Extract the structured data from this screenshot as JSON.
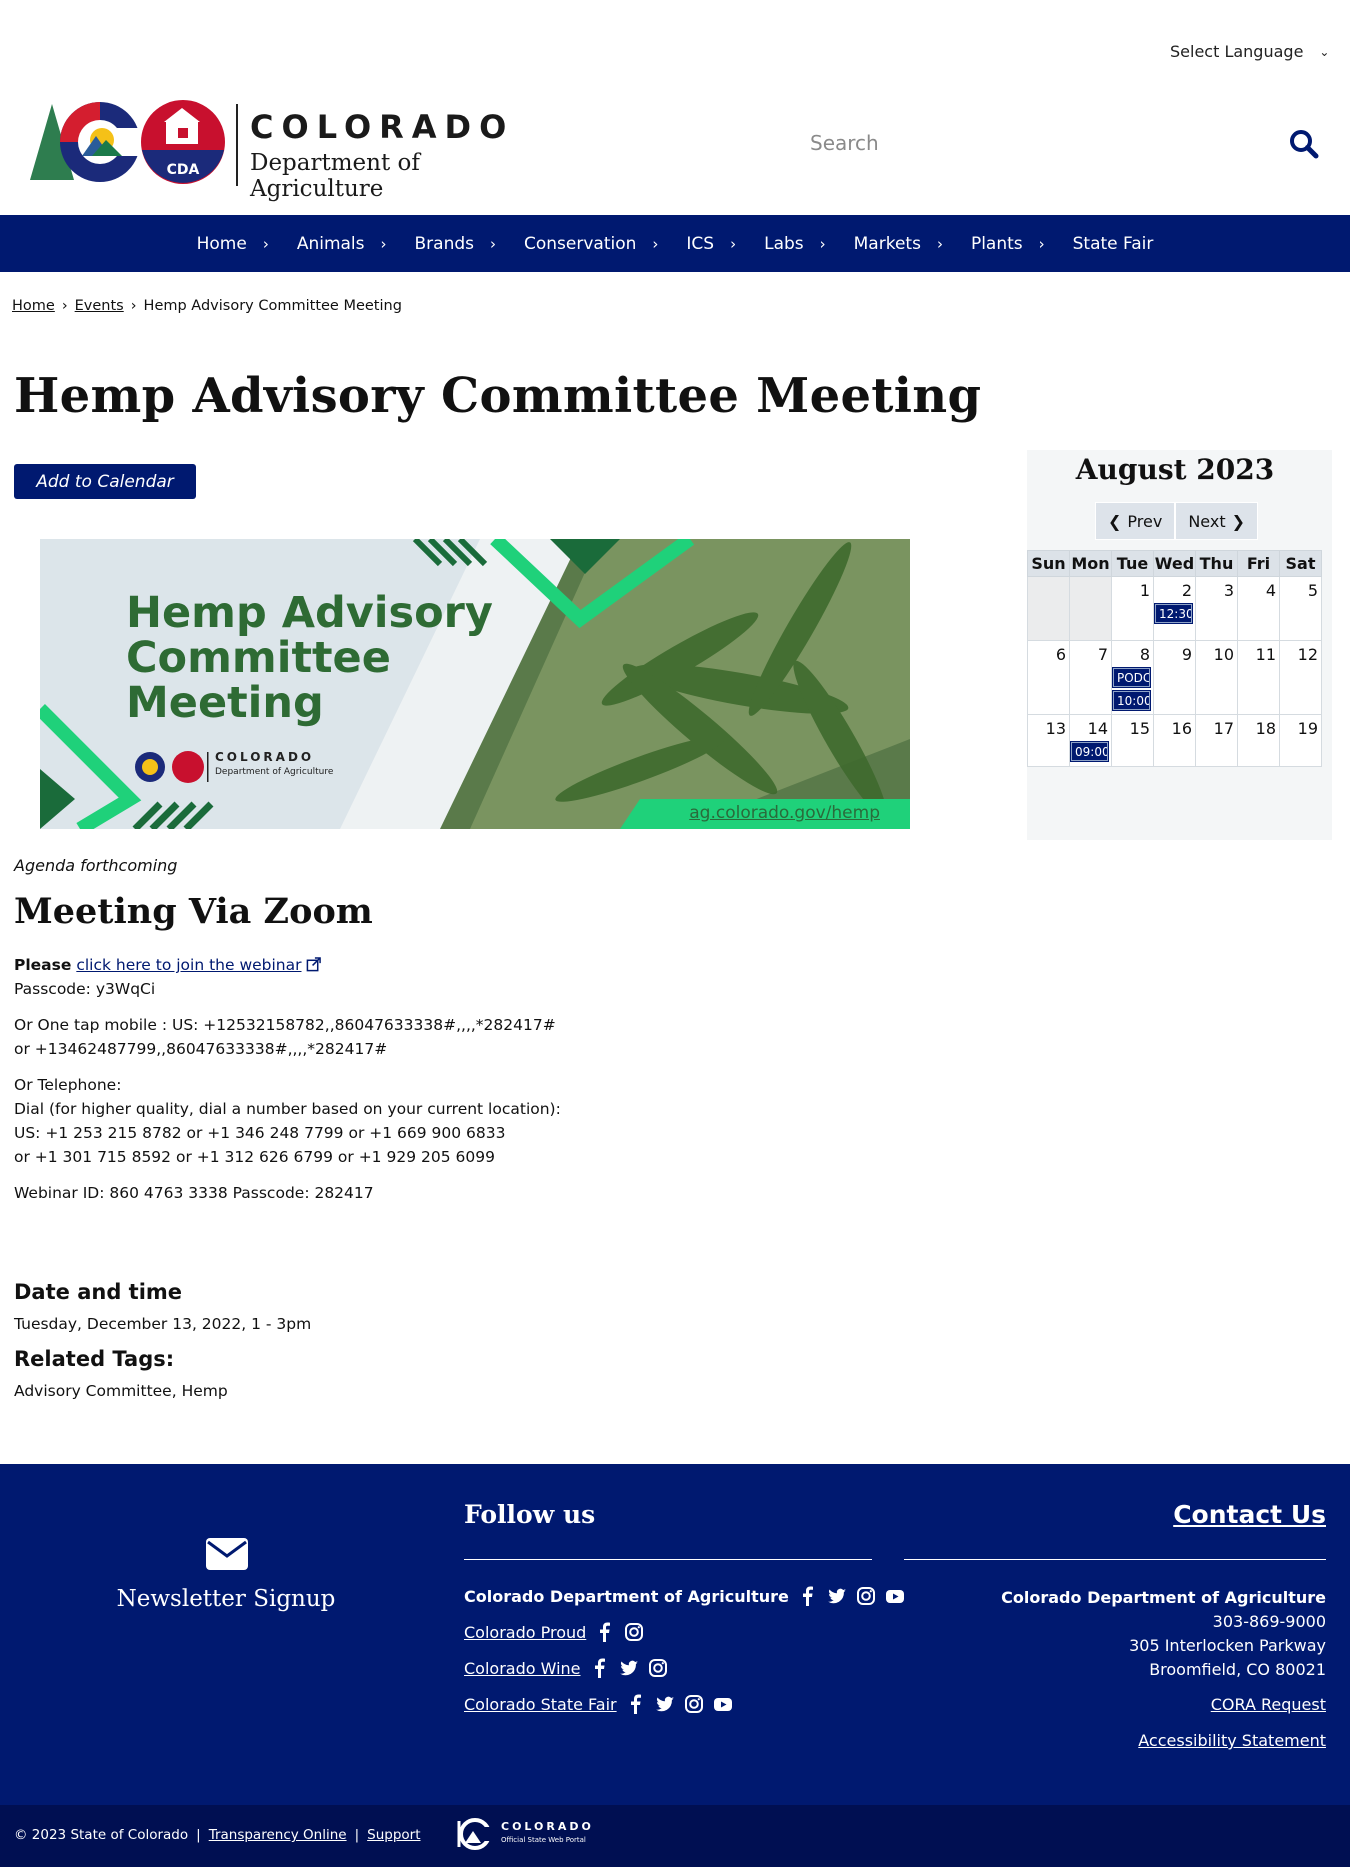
{
  "header": {
    "language_label": "Select Language",
    "logo_title": "COLORADO",
    "logo_subtitle": "Department of Agriculture",
    "logo_badge": "CDA",
    "search_placeholder": "Search"
  },
  "nav": {
    "items": [
      "Home",
      "Animals",
      "Brands",
      "Conservation",
      "ICS",
      "Labs",
      "Markets",
      "Plants",
      "State Fair"
    ],
    "background_color": "#001970"
  },
  "breadcrumb": {
    "items": [
      "Home",
      "Events",
      "Hemp Advisory Committee Meeting"
    ]
  },
  "page": {
    "title": "Hemp Advisory Committee Meeting",
    "add_to_calendar": "Add to Calendar"
  },
  "banner": {
    "title_line1": "Hemp Advisory",
    "title_line2": "Committee",
    "title_line3": "Meeting",
    "logo_title": "COLORADO",
    "logo_subtitle": "Department of Agriculture",
    "url": "ag.colorado.gov/hemp"
  },
  "content": {
    "agenda": "Agenda forthcoming",
    "zoom_heading": "Meeting Via Zoom",
    "please": "Please",
    "join_link": "click here to join the webinar",
    "passcode": "Passcode: y3WqCi",
    "one_tap_1": "Or One tap mobile : US: +12532158782,,86047633338#,,,,*282417#",
    "one_tap_2": "or +13462487799,,86047633338#,,,,*282417#",
    "telephone_label": "Or Telephone:",
    "dial_note": "Dial (for higher quality, dial a number based on your current location):",
    "numbers_1": "US: +1 253 215 8782 or +1 346 248 7799 or +1 669 900 6833",
    "numbers_2": "or +1 301 715 8592 or +1 312 626 6799 or +1 929 205 6099",
    "webinar_id": "Webinar ID: 860 4763 3338 Passcode: 282417",
    "date_heading": "Date and time",
    "date_value": "Tuesday, December 13, 2022, 1 - 3pm",
    "tags_heading": "Related Tags:",
    "tags_value": "Advisory Committee, Hemp"
  },
  "calendar": {
    "month_label": "August 2023",
    "prev_label": "Prev",
    "next_label": "Next",
    "weekdays": [
      "Sun",
      "Mon",
      "Tue",
      "Wed",
      "Thu",
      "Fri",
      "Sat"
    ],
    "weeks": [
      [
        {
          "day": ""
        },
        {
          "day": ""
        },
        {
          "day": "1"
        },
        {
          "day": "2",
          "events": [
            "12:30"
          ]
        },
        {
          "day": "3"
        },
        {
          "day": "4"
        },
        {
          "day": "5"
        }
      ],
      [
        {
          "day": "6"
        },
        {
          "day": "7"
        },
        {
          "day": "8",
          "events": [
            "PODC",
            "10:00"
          ]
        },
        {
          "day": "9"
        },
        {
          "day": "10"
        },
        {
          "day": "11"
        },
        {
          "day": "12"
        }
      ],
      [
        {
          "day": "13"
        },
        {
          "day": "14",
          "events": [
            "09:00"
          ]
        },
        {
          "day": "15"
        },
        {
          "day": "16"
        },
        {
          "day": "17"
        },
        {
          "day": "18"
        },
        {
          "day": "19"
        }
      ]
    ]
  },
  "footer": {
    "newsletter_label": "Newsletter Signup",
    "follow_heading": "Follow us",
    "social": [
      {
        "label": "Colorado Department of Agriculture",
        "icons": [
          "facebook-icon",
          "twitter-icon",
          "instagram-icon",
          "youtube-icon"
        ],
        "link": false
      },
      {
        "label": "Colorado Proud",
        "icons": [
          "facebook-icon",
          "instagram-icon"
        ],
        "link": true
      },
      {
        "label": "Colorado Wine",
        "icons": [
          "facebook-icon",
          "twitter-icon",
          "instagram-icon"
        ],
        "link": true
      },
      {
        "label": "Colorado State Fair",
        "icons": [
          "facebook-icon",
          "twitter-icon",
          "instagram-icon",
          "youtube-icon"
        ],
        "link": true
      }
    ],
    "contact_heading": "Contact Us",
    "org_name": "Colorado Department of Agriculture",
    "phone": "303-869-9000",
    "address_1": "305 Interlocken Parkway",
    "address_2": "Broomfield, CO 80021",
    "cora_link": "CORA Request",
    "accessibility_link": "Accessibility Statement"
  },
  "bottom_bar": {
    "copyright": "© 2023 State of Colorado",
    "transparency_link": "Transparency Online",
    "support_link": "Support",
    "portal_title": "COLORADO",
    "portal_subtitle": "Official State Web Portal"
  }
}
